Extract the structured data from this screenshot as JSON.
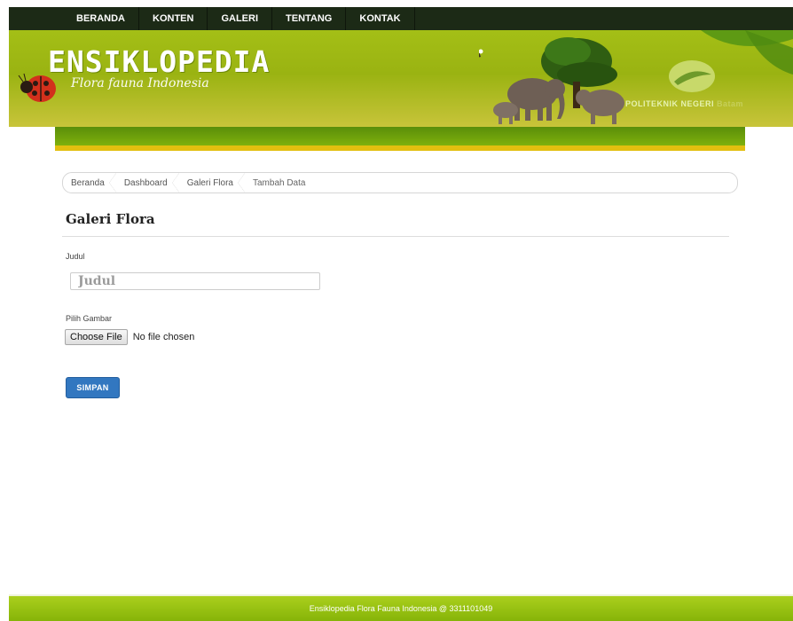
{
  "nav": {
    "items": [
      {
        "label": "BERANDA"
      },
      {
        "label": "KONTEN"
      },
      {
        "label": "GALERI"
      },
      {
        "label": "TENTANG"
      },
      {
        "label": "KONTAK"
      }
    ]
  },
  "header": {
    "brand": "ENSIKLOPEDIA",
    "tagline": "Flora fauna Indonesia",
    "school": "POLITEKNIK NEGERI",
    "school_suffix": "Batam",
    "colors": {
      "banner": "#a4bf16",
      "nav": "#1c2a16",
      "accent_bar": "#e3bf0f"
    }
  },
  "breadcrumb": {
    "items": [
      "Beranda",
      "Dashboard",
      "Galeri Flora",
      "Tambah Data"
    ]
  },
  "page": {
    "title": "Galeri Flora"
  },
  "form": {
    "judul_label": "Judul",
    "judul_placeholder": "Judul",
    "judul_value": "",
    "gambar_label": "Pilih Gambar",
    "file_button": "Choose File",
    "file_status": "No file chosen",
    "submit_label": "SIMPAN",
    "submit_color": "#3277c0"
  },
  "footer": {
    "text": "Ensiklopedia Flora Fauna Indonesia @ 3311101049"
  },
  "icons": [
    "ladybug-icon",
    "eagle-icon",
    "elephant-icon",
    "tree-icon",
    "polytechnic-logo-icon"
  ]
}
